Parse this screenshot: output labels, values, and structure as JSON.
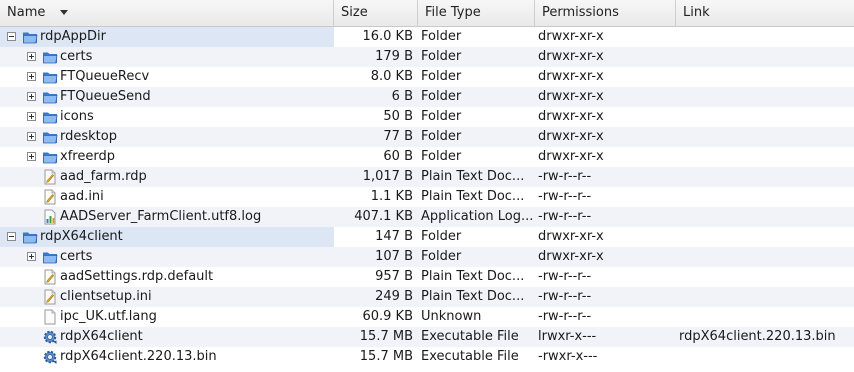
{
  "columns": {
    "name": "Name",
    "size": "Size",
    "type": "File Type",
    "permissions": "Permissions",
    "link": "Link"
  },
  "rows": [
    {
      "name": "rdpAppDir",
      "size": "16.0 KB",
      "type": "Folder",
      "permissions": "drwxr-xr-x",
      "link": "",
      "icon": "folder-icon",
      "level": 0,
      "expander": "collapse"
    },
    {
      "name": "certs",
      "size": "179 B",
      "type": "Folder",
      "permissions": "drwxr-xr-x",
      "link": "",
      "icon": "folder-icon",
      "level": 1,
      "expander": "expand"
    },
    {
      "name": "FTQueueRecv",
      "size": "8.0 KB",
      "type": "Folder",
      "permissions": "drwxr-xr-x",
      "link": "",
      "icon": "folder-icon",
      "level": 1,
      "expander": "expand"
    },
    {
      "name": "FTQueueSend",
      "size": "6 B",
      "type": "Folder",
      "permissions": "drwxr-xr-x",
      "link": "",
      "icon": "folder-icon",
      "level": 1,
      "expander": "expand"
    },
    {
      "name": "icons",
      "size": "50 B",
      "type": "Folder",
      "permissions": "drwxr-xr-x",
      "link": "",
      "icon": "folder-icon",
      "level": 1,
      "expander": "expand"
    },
    {
      "name": "rdesktop",
      "size": "77 B",
      "type": "Folder",
      "permissions": "drwxr-xr-x",
      "link": "",
      "icon": "folder-icon",
      "level": 1,
      "expander": "expand"
    },
    {
      "name": "xfreerdp",
      "size": "60 B",
      "type": "Folder",
      "permissions": "drwxr-xr-x",
      "link": "",
      "icon": "folder-icon",
      "level": 1,
      "expander": "expand"
    },
    {
      "name": "aad_farm.rdp",
      "size": "1,017 B",
      "type": "Plain Text Doc...",
      "permissions": "-rw-r--r--",
      "link": "",
      "icon": "text-file-icon",
      "level": 1,
      "expander": "none"
    },
    {
      "name": "aad.ini",
      "size": "1.1 KB",
      "type": "Plain Text Doc...",
      "permissions": "-rw-r--r--",
      "link": "",
      "icon": "text-file-icon",
      "level": 1,
      "expander": "none"
    },
    {
      "name": "AADServer_FarmClient.utf8.log",
      "size": "407.1 KB",
      "type": "Application Log...",
      "permissions": "-rw-r--r--",
      "link": "",
      "icon": "log-file-icon",
      "level": 1,
      "expander": "none"
    },
    {
      "name": "rdpX64client",
      "size": "147 B",
      "type": "Folder",
      "permissions": "drwxr-xr-x",
      "link": "",
      "icon": "folder-icon",
      "level": 0,
      "expander": "collapse"
    },
    {
      "name": "certs",
      "size": "107 B",
      "type": "Folder",
      "permissions": "drwxr-xr-x",
      "link": "",
      "icon": "folder-icon",
      "level": 1,
      "expander": "expand"
    },
    {
      "name": "aadSettings.rdp.default",
      "size": "957 B",
      "type": "Plain Text Doc...",
      "permissions": "-rw-r--r--",
      "link": "",
      "icon": "text-file-icon",
      "level": 1,
      "expander": "none"
    },
    {
      "name": "clientsetup.ini",
      "size": "249 B",
      "type": "Plain Text Doc...",
      "permissions": "-rw-r--r--",
      "link": "",
      "icon": "text-file-icon",
      "level": 1,
      "expander": "none"
    },
    {
      "name": "ipc_UK.utf.lang",
      "size": "60.9 KB",
      "type": "Unknown",
      "permissions": "-rw-r--r--",
      "link": "",
      "icon": "blank-file-icon",
      "level": 1,
      "expander": "none"
    },
    {
      "name": "rdpX64client",
      "size": "15.7 MB",
      "type": "Executable File",
      "permissions": "lrwxr-x---",
      "link": "rdpX64client.220.13.bin",
      "icon": "executable-icon",
      "level": 1,
      "expander": "none"
    },
    {
      "name": "rdpX64client.220.13.bin",
      "size": "15.7 MB",
      "type": "Executable File",
      "permissions": "-rwxr-x---",
      "link": "",
      "icon": "executable-icon",
      "level": 1,
      "expander": "none"
    }
  ]
}
